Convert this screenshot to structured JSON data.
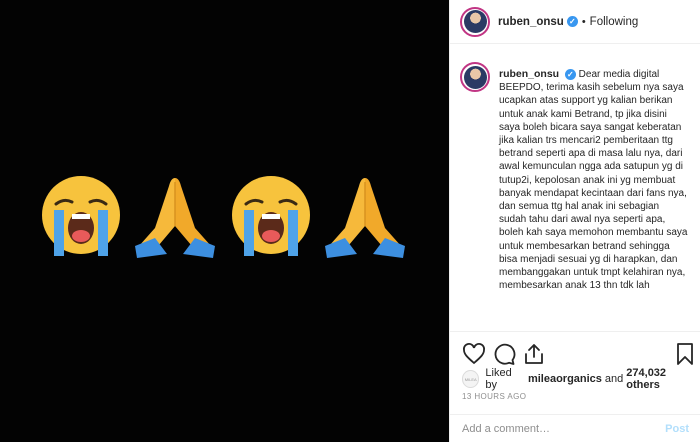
{
  "post": {
    "media_emojis": [
      {
        "name": "crying-face",
        "char": "😭"
      },
      {
        "name": "folded-hands",
        "char": "🙏"
      },
      {
        "name": "crying-face",
        "char": "😭"
      },
      {
        "name": "folded-hands",
        "char": "🙏"
      }
    ]
  },
  "header": {
    "username": "ruben_onsu",
    "verified_icon": "verified-badge-icon",
    "separator": "•",
    "follow_status": "Following"
  },
  "caption": {
    "username": "ruben_onsu",
    "text": "Dear media digital BEEPDO, terima kasih sebelum nya saya ucapkan atas support yg kalian berikan untuk anak kami Betrand, tp jika disini saya boleh bicara saya sangat keberatan jika kalian trs mencari2 pemberitaan ttg betrand seperti apa di masa lalu nya, dari awal kemunculan ngga ada satupun yg di tutup2i, kepolosan anak ini yg membuat banyak mendapat kecintaan dari fans nya, dan semua ttg hal anak ini sebagian sudah tahu dari awal nya seperti apa, boleh kah saya memohon membantu saya untuk membesarkan betrand sehingga bisa menjadi sesuai yg di harapkan, dan membanggakan untuk tmpt kelahiran nya, membesarkan anak 13 thn tdk lah"
  },
  "actions": {
    "icons": [
      "heart-icon",
      "comment-icon",
      "share-icon",
      "bookmark-icon"
    ]
  },
  "likes": {
    "prefix": "Liked by",
    "user": "mileaorganics",
    "conjunction": "and",
    "count": "274,032 others"
  },
  "timestamp": "13 HOURS AGO",
  "comment": {
    "placeholder": "Add a comment…",
    "post_label": "Post"
  },
  "colors": {
    "media_bg": "#030303",
    "verified": "#3897f0",
    "post_disabled": "#b2dffc",
    "muted": "#8e8e8e"
  }
}
